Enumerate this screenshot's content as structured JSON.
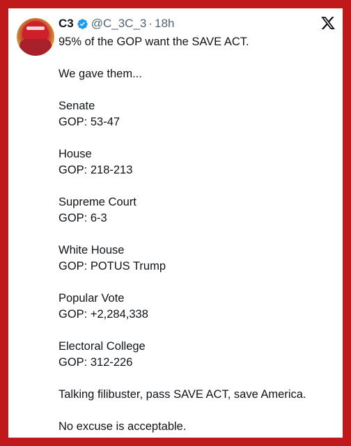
{
  "tweet": {
    "author_name": "C3",
    "handle": "@C_3C_3",
    "separator": "·",
    "time": "18h",
    "lines": [
      "95% of the GOP want the SAVE ACT.",
      "",
      "We gave them...",
      "",
      "Senate",
      "GOP: 53-47",
      "",
      "House",
      "GOP: 218-213",
      "",
      "Supreme Court",
      "GOP: 6-3",
      "",
      "White House",
      "GOP: POTUS Trump",
      "",
      "Popular Vote",
      "GOP: +2,284,338",
      "",
      "Electoral College",
      "GOP: 312-226",
      "",
      "Talking filibuster, pass SAVE ACT, save America.",
      "",
      "No excuse is acceptable."
    ]
  },
  "icons": {
    "verified": "verified-badge-icon",
    "platform": "x-logo-icon",
    "avatar": "profile-avatar"
  },
  "colors": {
    "border": "#c0191c",
    "verified": "#1d9bf0",
    "text": "#0f1419",
    "muted": "#536471"
  }
}
